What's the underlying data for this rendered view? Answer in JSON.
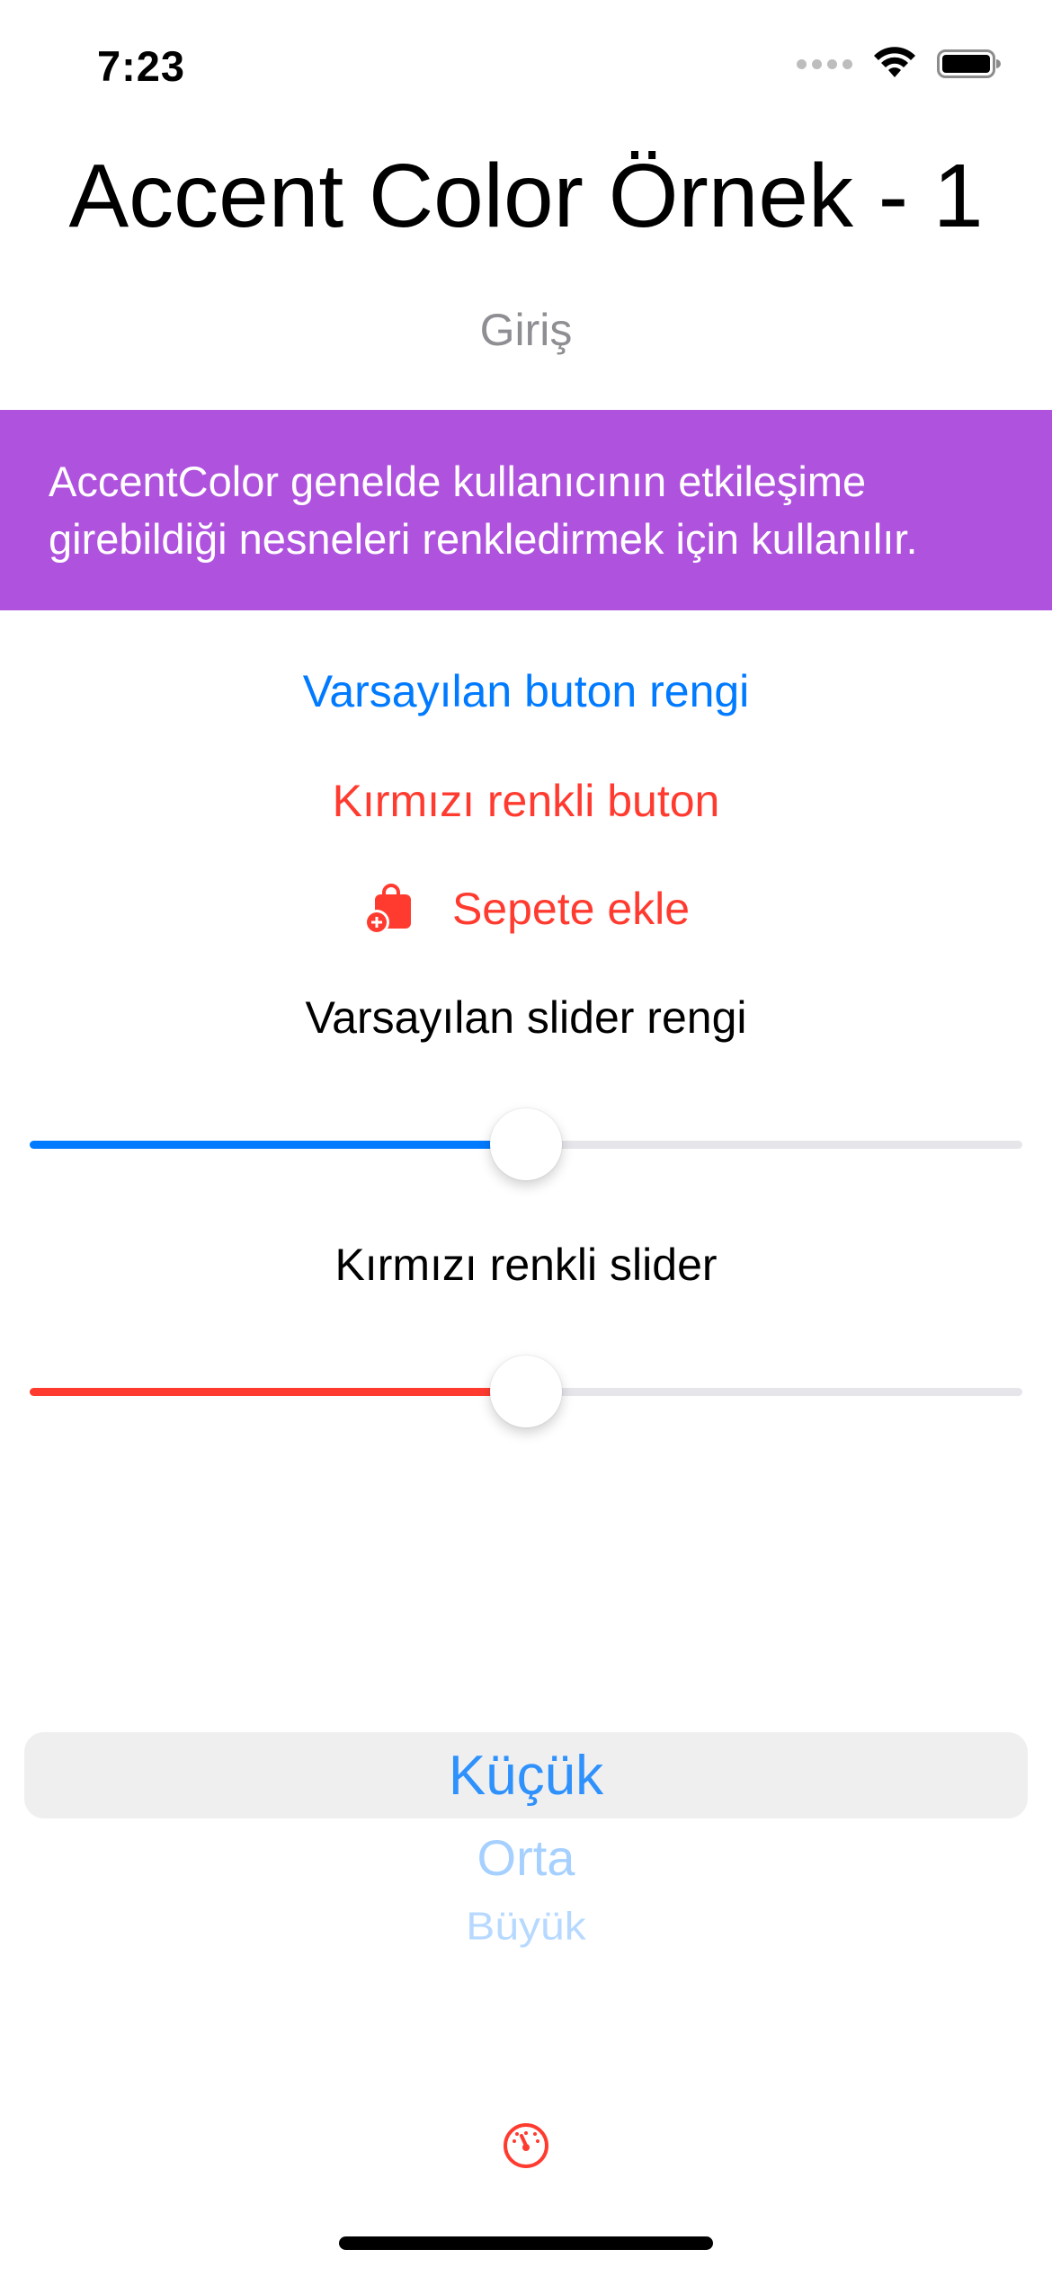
{
  "status_bar": {
    "time": "7:23"
  },
  "header": {
    "title": "Accent Color Örnek - 1",
    "subtitle": "Giriş"
  },
  "banner": {
    "text": "AccentColor genelde kullanıcının etkileşime girebildiği nesneleri renkledirmek için kullanılır.",
    "background_color": "#af52de"
  },
  "buttons": {
    "default_label": "Varsayılan buton rengi",
    "red_label": "Kırmızı renkli buton",
    "cart_label": "Sepete ekle",
    "cart_icon": "bag-badge-plus-icon"
  },
  "sliders": {
    "default_label": "Varsayılan slider rengi",
    "default_value": 0.5,
    "default_color": "#007aff",
    "red_label": "Kırmızı renkli slider",
    "red_value": 0.5,
    "red_color": "#ff3b30"
  },
  "picker": {
    "options": [
      "Küçük",
      "Orta",
      "Büyük"
    ],
    "selected": "Küçük"
  },
  "footer": {
    "icon": "gauge-icon"
  },
  "colors": {
    "accent_blue": "#007aff",
    "accent_red": "#ff3b30"
  }
}
